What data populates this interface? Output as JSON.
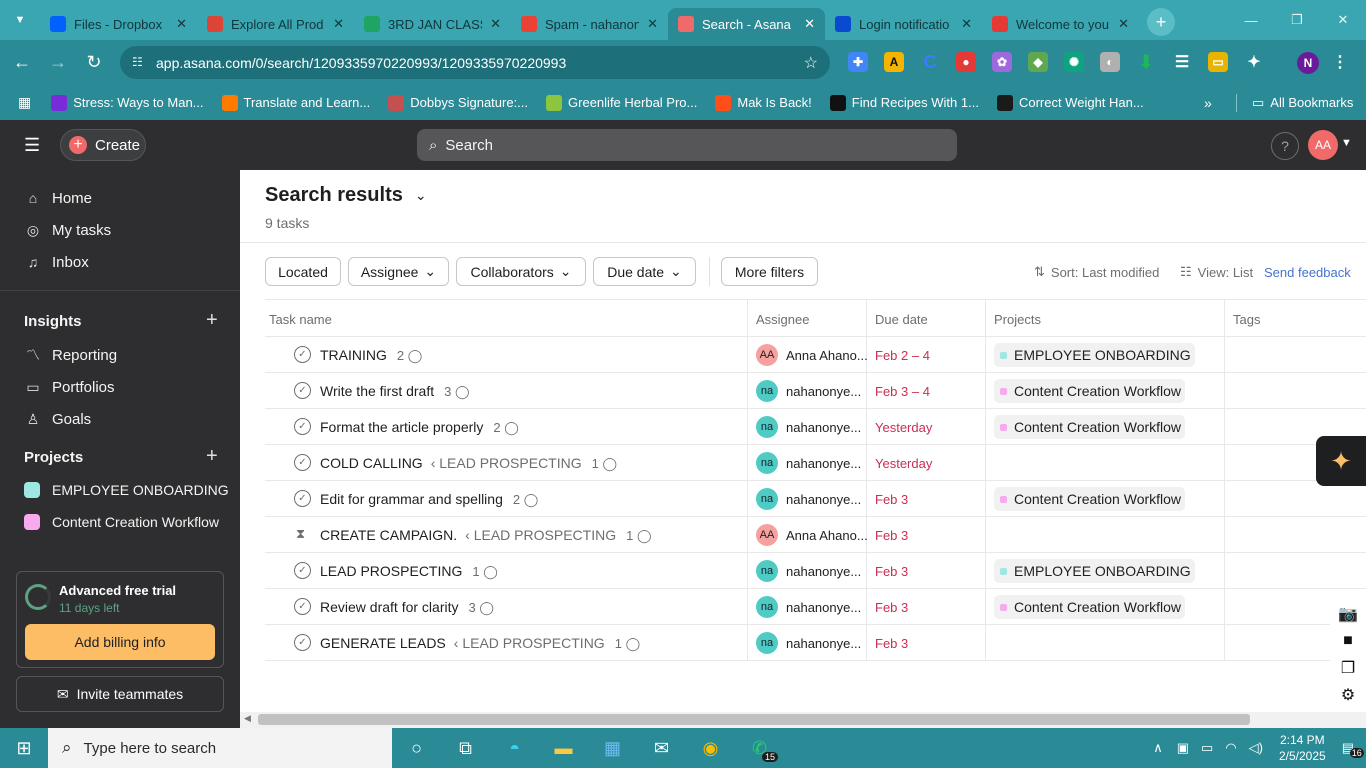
{
  "browser": {
    "tabs": [
      {
        "title": "Files - Dropbox",
        "icon_color": "#0061fe",
        "icon": "dropbox-icon"
      },
      {
        "title": "Explore All Prod",
        "icon_color": "#db4437",
        "icon": "chrome-icon"
      },
      {
        "title": "3RD JAN CLASS",
        "icon_color": "#1fa463",
        "icon": "drive-icon"
      },
      {
        "title": "Spam - nahanon",
        "icon_color": "#ea4335",
        "icon": "gmail-icon"
      },
      {
        "title": "Search - Asana",
        "icon_color": "#f06a6a",
        "icon": "asana-icon",
        "active": true
      },
      {
        "title": "Login notificatio",
        "icon_color": "#0a4ad1",
        "icon": "shield-icon"
      },
      {
        "title": "Welcome to you",
        "icon_color": "#e53935",
        "icon": "heart-icon"
      }
    ],
    "url": "app.asana.com/0/search/1209335970220993/1209335970220993",
    "bookmarks": [
      {
        "label": "Stress: Ways to Man...",
        "color": "#7a2bd9"
      },
      {
        "label": "Translate and Learn...",
        "color": "#ff7b00"
      },
      {
        "label": "Dobbys Signature:...",
        "color": "#c45050"
      },
      {
        "label": "Greenlife Herbal Pro...",
        "color": "#8cc63f"
      },
      {
        "label": "Mak Is Back!",
        "color": "#ff4e1a"
      },
      {
        "label": "Find Recipes With 1...",
        "color": "#111111"
      },
      {
        "label": "Correct Weight Han...",
        "color": "#1a1a1a"
      }
    ],
    "all_bookmarks": "All Bookmarks"
  },
  "topbar": {
    "create_label": "Create",
    "search_placeholder": "Search",
    "help": "?",
    "avatar": "AA"
  },
  "sidebar": {
    "nav": [
      {
        "label": "Home",
        "icon": "home-icon"
      },
      {
        "label": "My tasks",
        "icon": "check-circle-icon"
      },
      {
        "label": "Inbox",
        "icon": "bell-icon"
      }
    ],
    "insights_header": "Insights",
    "insights": [
      {
        "label": "Reporting",
        "icon": "chart-line-icon"
      },
      {
        "label": "Portfolios",
        "icon": "folder-icon"
      },
      {
        "label": "Goals",
        "icon": "person-goal-icon"
      }
    ],
    "projects_header": "Projects",
    "projects": [
      {
        "label": "EMPLOYEE ONBOARDING",
        "color": "#9ee7e3"
      },
      {
        "label": "Content Creation Workflow",
        "color": "#f9aaef"
      }
    ],
    "trial_title": "Advanced free trial",
    "trial_days": "11 days left",
    "billing_button": "Add billing info",
    "invite_button": "Invite teammates"
  },
  "main": {
    "title": "Search results",
    "count": "9 tasks",
    "filters": [
      "Located",
      "Assignee",
      "Collaborators",
      "Due date",
      "More filters"
    ],
    "sort": "Sort: Last modified",
    "view": "View: List",
    "feedback": "Send feedback",
    "columns": [
      "Task name",
      "Assignee",
      "Due date",
      "Projects",
      "Tags"
    ],
    "rows": [
      {
        "name": "TRAINING",
        "parent": "",
        "comments": "2",
        "assignee_initials": "AA",
        "assignee": "Anna Ahano...",
        "avatar_color": "#f7a0a0",
        "due": "Feb 2 – 4",
        "project": "EMPLOYEE ONBOARDING",
        "project_color": "#9ee7e3",
        "icon": "check"
      },
      {
        "name": "Write the first draft",
        "parent": "",
        "comments": "3",
        "assignee_initials": "na",
        "assignee": "nahanonye...",
        "avatar_color": "#4ecbc4",
        "due": "Feb 3 – 4",
        "project": "Content Creation Workflow",
        "project_color": "#f9aaef",
        "icon": "check"
      },
      {
        "name": "Format the article properly",
        "parent": "",
        "comments": "2",
        "assignee_initials": "na",
        "assignee": "nahanonye...",
        "avatar_color": "#4ecbc4",
        "due": "Yesterday",
        "project": "Content Creation Workflow",
        "project_color": "#f9aaef",
        "icon": "check"
      },
      {
        "name": "COLD CALLING",
        "parent": "‹ LEAD PROSPECTING",
        "comments": "1",
        "assignee_initials": "na",
        "assignee": "nahanonye...",
        "avatar_color": "#4ecbc4",
        "due": "Yesterday",
        "project": "",
        "project_color": "",
        "icon": "check"
      },
      {
        "name": "Edit for grammar and spelling",
        "parent": "",
        "comments": "2",
        "assignee_initials": "na",
        "assignee": "nahanonye...",
        "avatar_color": "#4ecbc4",
        "due": "Feb 3",
        "project": "Content Creation Workflow",
        "project_color": "#f9aaef",
        "icon": "check"
      },
      {
        "name": "CREATE CAMPAIGN.",
        "parent": "‹ LEAD PROSPECTING",
        "comments": "1",
        "assignee_initials": "AA",
        "assignee": "Anna Ahano...",
        "avatar_color": "#f7a0a0",
        "due": "Feb 3",
        "project": "",
        "project_color": "",
        "icon": "hourglass"
      },
      {
        "name": "LEAD PROSPECTING",
        "parent": "",
        "comments": "1",
        "assignee_initials": "na",
        "assignee": "nahanonye...",
        "avatar_color": "#4ecbc4",
        "due": "Feb 3",
        "project": "EMPLOYEE ONBOARDING",
        "project_color": "#9ee7e3",
        "icon": "check"
      },
      {
        "name": "Review draft for clarity",
        "parent": "",
        "comments": "3",
        "assignee_initials": "na",
        "assignee": "nahanonye...",
        "avatar_color": "#4ecbc4",
        "due": "Feb 3",
        "project": "Content Creation Workflow",
        "project_color": "#f9aaef",
        "icon": "check"
      },
      {
        "name": "GENERATE LEADS",
        "parent": "‹ LEAD PROSPECTING",
        "comments": "1",
        "assignee_initials": "na",
        "assignee": "nahanonye...",
        "avatar_color": "#4ecbc4",
        "due": "Feb 3",
        "project": "",
        "project_color": "",
        "icon": "check"
      }
    ]
  },
  "taskbar": {
    "search_placeholder": "Type here to search",
    "whatsapp_badge": "15",
    "time": "2:14 PM",
    "date": "2/5/2025",
    "notifications": "16"
  }
}
